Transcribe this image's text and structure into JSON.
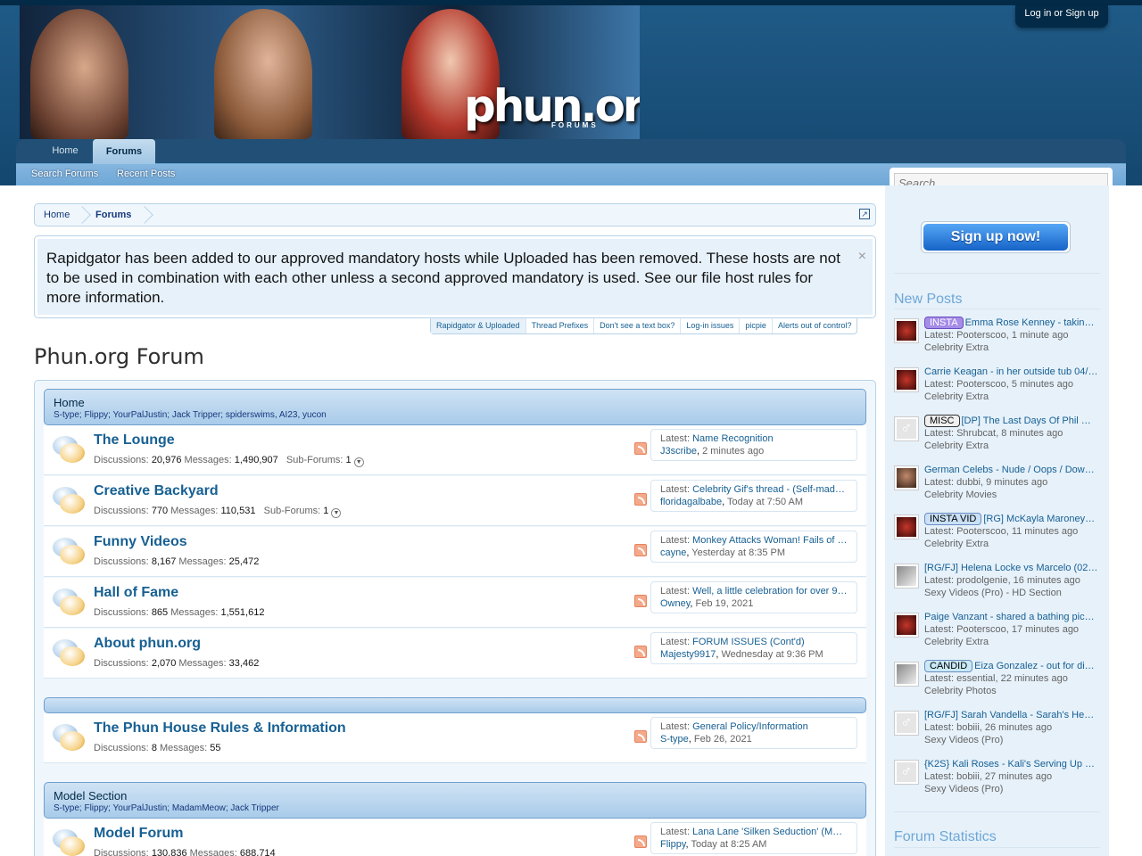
{
  "header": {
    "logo_text": "phun.org",
    "logo_sub": "FORUMS",
    "login_label": "Log in or Sign up"
  },
  "nav": {
    "tabs": [
      {
        "label": "Home"
      },
      {
        "label": "Forums"
      }
    ],
    "sub_links": [
      {
        "label": "Search Forums"
      },
      {
        "label": "Recent Posts"
      }
    ],
    "search_placeholder": "Search..."
  },
  "breadcrumb": [
    {
      "label": "Home"
    },
    {
      "label": "Forums"
    }
  ],
  "notice": {
    "text": "Rapidgator has been added to our approved mandatory hosts while Uploaded has been removed. These hosts are not to be used in combination with each other unless a second approved mandatory is used. See our file host rules for more information.",
    "close": "×",
    "tabs": [
      "Rapidgator & Uploaded",
      "Thread Prefixes",
      "Don't see a text box?",
      "Log-in issues",
      "picpie",
      "Alerts out of control?"
    ]
  },
  "page_title": "Phun.org Forum",
  "categories": [
    {
      "title": "Home",
      "desc": "S-type; Flippy; YourPalJustin; Jack Tripper; spiderswims, AI23, yucon"
    },
    {
      "title": "",
      "desc": ""
    },
    {
      "title": "Model Section",
      "desc": "S-type; Flippy; YourPalJustin; MadamMeow; Jack Tripper"
    }
  ],
  "labels": {
    "discussions": "Discussions:",
    "messages": "Messages:",
    "subforums": "Sub-Forums:",
    "latest": "Latest:"
  },
  "nodes": [
    {
      "title": "The Lounge",
      "discussions": "20,976",
      "messages": "1,490,907",
      "subforums": "1",
      "latest_title": "Name Recognition",
      "latest_user": "J3scribe",
      "latest_time": "2 minutes ago"
    },
    {
      "title": "Creative Backyard",
      "discussions": "770",
      "messages": "110,531",
      "subforums": "1",
      "latest_title": "Celebrity Gif's thread - (Self-mad…",
      "latest_user": "floridagalbabe",
      "latest_time": "Today at 7:50 AM"
    },
    {
      "title": "Funny Videos",
      "discussions": "8,167",
      "messages": "25,472",
      "latest_title": "Monkey Attacks Woman! Fails of …",
      "latest_user": "cayne",
      "latest_time": "Yesterday at 8:35 PM"
    },
    {
      "title": "Hall of Fame",
      "discussions": "865",
      "messages": "1,551,612",
      "latest_title": "Well, a little celebration for over 9…",
      "latest_user": "Owney",
      "latest_time": "Feb 19, 2021"
    },
    {
      "title": "About phun.org",
      "discussions": "2,070",
      "messages": "33,462",
      "latest_title": "FORUM ISSUES (Cont'd)",
      "latest_user": "Majesty9917",
      "latest_time": "Wednesday at 9:36 PM"
    },
    {
      "title": "The Phun House Rules & Information",
      "discussions": "8",
      "messages": "55",
      "latest_title": "General Policy/Information",
      "latest_user": "S-type",
      "latest_time": "Feb 26, 2021"
    },
    {
      "title": "Model Forum",
      "discussions": "130,836",
      "messages": "688,714",
      "latest_title": "Lana Lane 'Silken Seduction' (M…",
      "latest_user": "Flippy",
      "latest_time": "Today at 8:25 AM"
    }
  ],
  "sidebar": {
    "signup_label": "Sign up now!",
    "new_posts_title": "New Posts",
    "stats_title": "Forum Statistics",
    "posts": [
      {
        "prefix": "INSTA",
        "title": "Emma Rose Kenney - takin…",
        "latest": "Latest: Pooterscoo, 1 minute ago",
        "forum": "Celebrity Extra"
      },
      {
        "prefix": "",
        "title": "Carrie Keagan - in her outside tub 04/…",
        "latest": "Latest: Pooterscoo, 5 minutes ago",
        "forum": "Celebrity Extra"
      },
      {
        "prefix": "MISC",
        "title": "[DP] The Last Days Of Phil …",
        "latest": "Latest: Shrubcat, 8 minutes ago",
        "forum": "Celebrity Extra"
      },
      {
        "prefix": "",
        "title": "German Celebs - Nude / Oops / Dow…",
        "latest": "Latest: dubbi, 9 minutes ago",
        "forum": "Celebrity Movies"
      },
      {
        "prefix": "INSTA VID",
        "title": "[RG] McKayla Maroney…",
        "latest": "Latest: Pooterscoo, 11 minutes ago",
        "forum": "Celebrity Extra"
      },
      {
        "prefix": "",
        "title": "[RG/FJ] Helena Locke vs Marcelo (02…",
        "latest": "Latest: prodolgenie, 16 minutes ago",
        "forum": "Sexy Videos (Pro) - HD Section"
      },
      {
        "prefix": "",
        "title": "Paige Vanzant - shared a bathing pic…",
        "latest": "Latest: Pooterscoo, 17 minutes ago",
        "forum": "Celebrity Extra"
      },
      {
        "prefix": "CANDID",
        "title": "Eiza Gonzalez - out for di…",
        "latest": "Latest: essential, 22 minutes ago",
        "forum": "Celebrity Photos"
      },
      {
        "prefix": "",
        "title": "[RG/FJ] Sarah Vandella - Sarah's He…",
        "latest": "Latest: bobiii, 26 minutes ago",
        "forum": "Sexy Videos (Pro)"
      },
      {
        "prefix": "",
        "title": "{K2S} Kali Roses - Kali's Serving Up …",
        "latest": "Latest: bobiii, 27 minutes ago",
        "forum": "Sexy Videos (Pro)"
      }
    ]
  }
}
